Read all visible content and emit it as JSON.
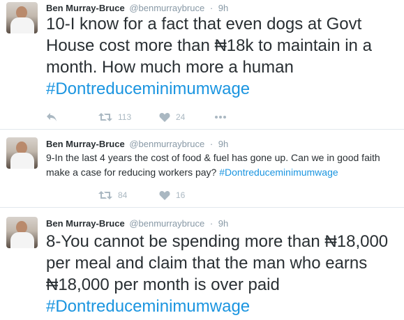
{
  "tweets": [
    {
      "name": "Ben Murray-Bruce",
      "handle": "@benmurraybruce",
      "sep": "·",
      "time": "9h",
      "text": "10-I know for a fact that even dogs at Govt House cost more than ₦18k to maintain in a month. How much more a human ",
      "hashtag": "#Dontreduceminimumwage",
      "retweets": "113",
      "likes": "24"
    },
    {
      "name": "Ben Murray-Bruce",
      "handle": "@benmurraybruce",
      "sep": "·",
      "time": "9h",
      "text": "9-In the last 4 years the cost of food & fuel has gone up. Can we in good faith make a case for reducing workers pay? ",
      "hashtag": "#Dontreduceminimumwage",
      "retweets": "84",
      "likes": "16"
    },
    {
      "name": "Ben Murray-Bruce",
      "handle": "@benmurraybruce",
      "sep": "·",
      "time": "9h",
      "text": "8-You cannot be spending more than ₦18,000 per meal and claim that the man who earns ₦18,000 per month is over paid ",
      "hashtag": "#Dontreduceminimumwage"
    }
  ],
  "colors": {
    "text": "#292f33",
    "muted": "#8899a6",
    "hashtag": "#1b95e0",
    "icon": "#aab8c2",
    "divider": "#e1e8ed"
  },
  "icons": [
    "reply-icon",
    "retweet-icon",
    "like-icon",
    "more-icon"
  ]
}
